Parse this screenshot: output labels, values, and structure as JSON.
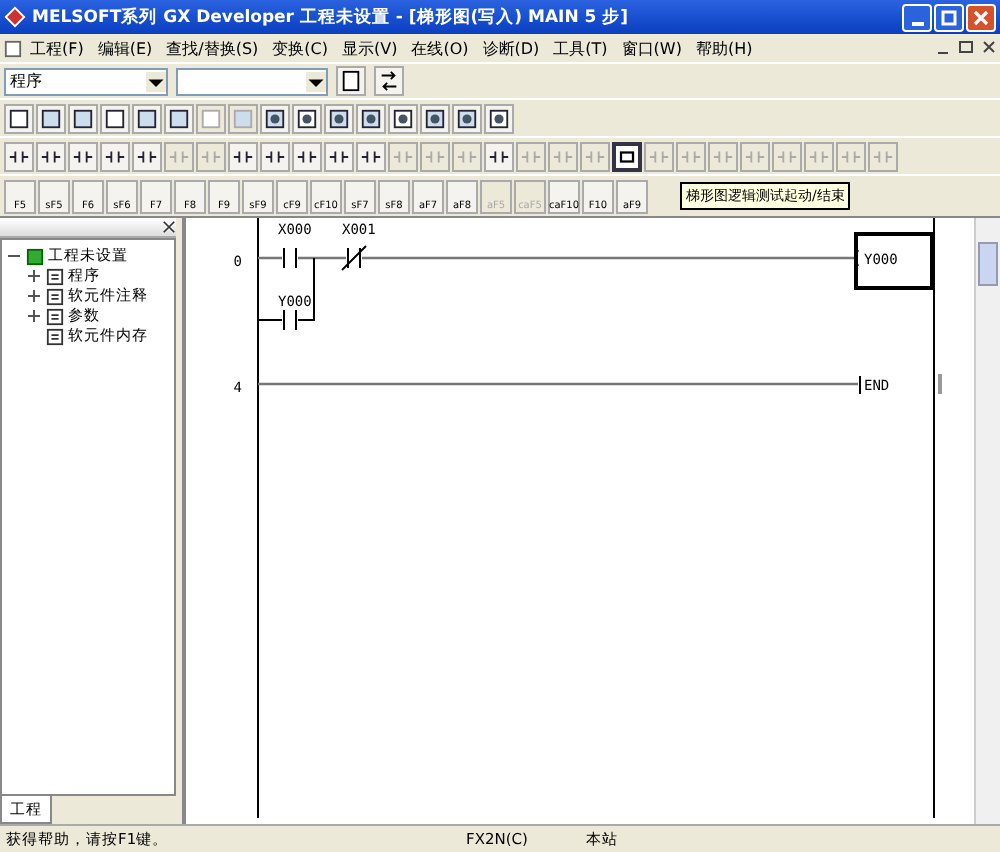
{
  "window": {
    "title": "MELSOFT系列 GX Developer 工程未设置 - [梯形图(写入)    MAIN    5 步]"
  },
  "menu": [
    "工程(F)",
    "编辑(E)",
    "查找/替换(S)",
    "变换(C)",
    "显示(V)",
    "在线(O)",
    "诊断(D)",
    "工具(T)",
    "窗口(W)",
    "帮助(H)"
  ],
  "combos": [
    {
      "value": "程序",
      "kind": "narrow"
    },
    {
      "kind": "wide"
    }
  ],
  "toolbar_1": [
    {
      "disabled": false
    },
    {
      "disabled": false
    },
    {
      "disabled": false
    },
    {
      "disabled": false
    },
    {
      "disabled": false
    },
    {
      "disabled": false
    },
    {
      "disabled": true
    },
    {
      "disabled": true
    },
    {
      "disabled": false
    },
    {
      "disabled": false
    },
    {
      "disabled": false
    },
    {
      "disabled": false
    },
    {
      "disabled": false
    },
    {
      "disabled": false
    },
    {
      "disabled": false
    },
    {
      "disabled": false
    }
  ],
  "toolbar_2": [
    {
      "disabled": false,
      "selected": false
    },
    {
      "disabled": false,
      "selected": false
    },
    {
      "disabled": false,
      "selected": false
    },
    {
      "disabled": false,
      "selected": false
    },
    {
      "disabled": false,
      "selected": false
    },
    {
      "disabled": true,
      "selected": false
    },
    {
      "disabled": true,
      "selected": false
    },
    {
      "disabled": false,
      "selected": false
    },
    {
      "disabled": false,
      "selected": false
    },
    {
      "disabled": false,
      "selected": false
    },
    {
      "disabled": false,
      "selected": false
    },
    {
      "disabled": false,
      "selected": false
    },
    {
      "disabled": true,
      "selected": false
    },
    {
      "disabled": true,
      "selected": false
    },
    {
      "disabled": true,
      "selected": false
    },
    {
      "disabled": false,
      "selected": false
    },
    {
      "disabled": true,
      "selected": false
    },
    {
      "disabled": true,
      "selected": false
    },
    {
      "disabled": true,
      "selected": false
    },
    {
      "disabled": false,
      "selected": true
    },
    {
      "disabled": true,
      "selected": false
    },
    {
      "disabled": true,
      "selected": false
    },
    {
      "disabled": true,
      "selected": false
    },
    {
      "disabled": true,
      "selected": false
    },
    {
      "disabled": true,
      "selected": false
    },
    {
      "disabled": true,
      "selected": false
    },
    {
      "disabled": true,
      "selected": false
    },
    {
      "disabled": true,
      "selected": false
    }
  ],
  "toolbar_3": [
    {
      "label": "F5",
      "disabled": false
    },
    {
      "label": "sF5",
      "disabled": false
    },
    {
      "label": "F6",
      "disabled": false
    },
    {
      "label": "sF6",
      "disabled": false
    },
    {
      "label": "F7",
      "disabled": false
    },
    {
      "label": "F8",
      "disabled": false
    },
    {
      "label": "F9",
      "disabled": false
    },
    {
      "label": "sF9",
      "disabled": false
    },
    {
      "label": "cF9",
      "disabled": false
    },
    {
      "label": "cF10",
      "disabled": false
    },
    {
      "label": "sF7",
      "disabled": false
    },
    {
      "label": "sF8",
      "disabled": false
    },
    {
      "label": "aF7",
      "disabled": false
    },
    {
      "label": "aF8",
      "disabled": false
    },
    {
      "label": "aF5",
      "disabled": true
    },
    {
      "label": "caF5",
      "disabled": true
    },
    {
      "label": "caF10",
      "disabled": false
    },
    {
      "label": "F10",
      "disabled": false
    },
    {
      "label": "aF9",
      "disabled": false
    }
  ],
  "tooltip": "梯形图逻辑测试起动/结束",
  "project_tree": {
    "label": "工程未设置",
    "expanded": true,
    "children": [
      {
        "label": "程序",
        "expanded": false
      },
      {
        "label": "软元件注释",
        "expanded": false
      },
      {
        "label": "参数",
        "expanded": false
      },
      {
        "label": "软元件内存"
      }
    ]
  },
  "left_tab": "工程",
  "ladder": {
    "rungs": [
      {
        "step": "0",
        "contacts": [
          {
            "device": "X000",
            "kind": "no"
          },
          {
            "device": "X001",
            "kind": "nc"
          }
        ],
        "branch": {
          "device": "Y000",
          "kind": "no"
        },
        "output": {
          "kind": "coil",
          "device": "Y000",
          "selected": true
        }
      },
      {
        "step": "4",
        "output": {
          "kind": "end",
          "device": "END",
          "selected": false
        }
      }
    ]
  },
  "status_bar": [
    "获得帮助，请按F1键。",
    "FX2N(C)",
    "本站"
  ]
}
